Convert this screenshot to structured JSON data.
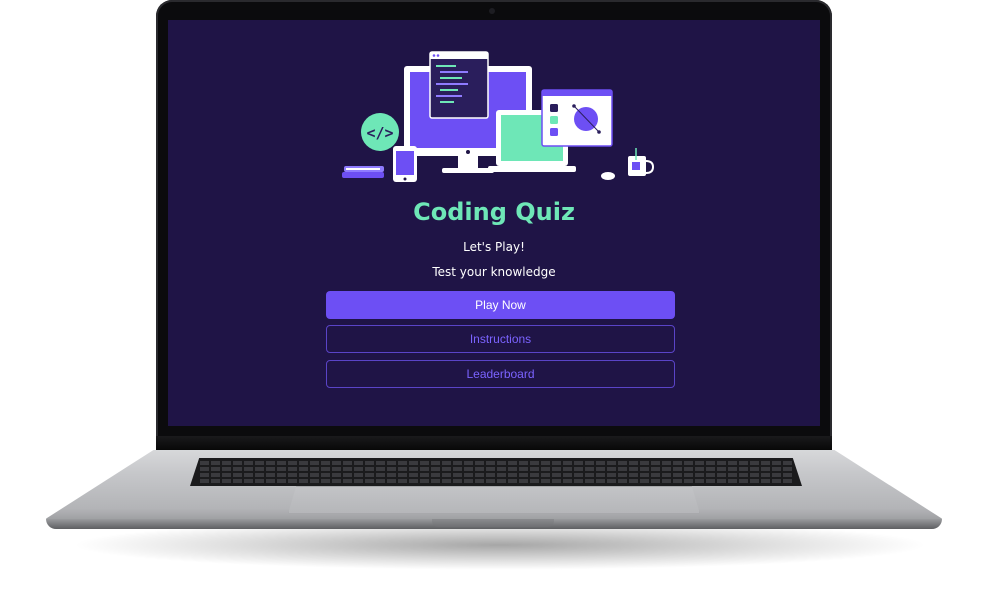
{
  "app": {
    "title": "Coding Quiz",
    "subtitle": "Let's Play!",
    "tagline": "Test your knowledge"
  },
  "buttons": {
    "play": "Play Now",
    "instructions": "Instructions",
    "leaderboard": "Leaderboard"
  },
  "illustration": {
    "code_icon_text": "</>",
    "icons": [
      "desktop-monitor-icon",
      "code-window-icon",
      "laptop-icon",
      "design-window-icon",
      "code-badge-icon",
      "phone-icon",
      "books-icon",
      "mouse-icon",
      "mug-icon"
    ]
  },
  "colors": {
    "screen_bg": "#1f1446",
    "accent_purple": "#6d4ff4",
    "accent_green": "#6ee7b7",
    "text_white": "#ffffff"
  }
}
